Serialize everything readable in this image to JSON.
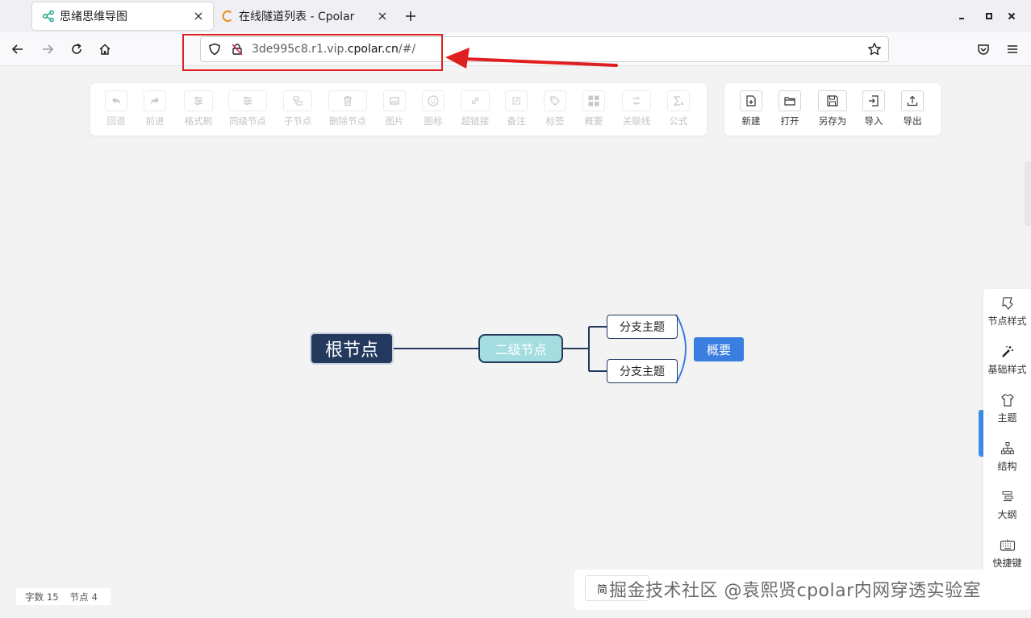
{
  "browser": {
    "tabs": [
      {
        "title": "思绪思维导图",
        "active": true,
        "icon": "mindmap-share-icon"
      },
      {
        "title": "在线隧道列表 - Cpolar",
        "active": false,
        "icon": "cpolar-c-icon"
      }
    ],
    "new_tab": "+",
    "url_host_pre": "3de995c8.r1.vip.",
    "url_host_main": "cpolar.cn",
    "url_path": "/#/"
  },
  "colors": {
    "root_fill": "#233a5e",
    "second_fill": "#a4dde0",
    "summary_fill": "#3a7fe0",
    "annotation_red": "#e02020",
    "sidebar_accent": "#3a8ee6"
  },
  "toolbar": {
    "edit_tools": [
      {
        "label": "回退",
        "icon": "undo-icon"
      },
      {
        "label": "前进",
        "icon": "redo-icon"
      },
      {
        "label": "格式刷",
        "icon": "format-brush-icon"
      },
      {
        "label": "同级节点",
        "icon": "sibling-node-icon"
      },
      {
        "label": "子节点",
        "icon": "child-node-icon"
      },
      {
        "label": "删除节点",
        "icon": "trash-icon"
      },
      {
        "label": "图片",
        "icon": "image-icon"
      },
      {
        "label": "图标",
        "icon": "smiley-icon"
      },
      {
        "label": "超链接",
        "icon": "link-icon"
      },
      {
        "label": "备注",
        "icon": "note-edit-icon"
      },
      {
        "label": "标签",
        "icon": "tag-icon"
      },
      {
        "label": "概要",
        "icon": "summary-grid-icon"
      },
      {
        "label": "关联线",
        "icon": "association-line-icon"
      },
      {
        "label": "公式",
        "icon": "formula-sigma-icon"
      }
    ],
    "file_tools": [
      {
        "label": "新建",
        "icon": "new-file-icon"
      },
      {
        "label": "打开",
        "icon": "folder-open-icon"
      },
      {
        "label": "另存为",
        "icon": "save-as-icon"
      },
      {
        "label": "导入",
        "icon": "import-icon"
      },
      {
        "label": "导出",
        "icon": "export-icon"
      }
    ]
  },
  "mindmap": {
    "root": "根节点",
    "second": "二级节点",
    "branches": [
      "分支主题",
      "分支主题"
    ],
    "summary": "概要"
  },
  "sidebar": [
    {
      "label": "节点样式",
      "icon": "node-style-icon"
    },
    {
      "label": "基础样式",
      "icon": "magic-wand-icon"
    },
    {
      "label": "主题",
      "icon": "tshirt-icon"
    },
    {
      "label": "结构",
      "icon": "structure-tree-icon"
    },
    {
      "label": "大纲",
      "icon": "outline-icon"
    },
    {
      "label": "快捷键",
      "icon": "keyboard-icon"
    }
  ],
  "status": {
    "words_label": "字数",
    "words_value": "15",
    "nodes_label": "节点",
    "nodes_value": "4"
  },
  "bottom": {
    "lang_label": "简",
    "watermark": "掘金技术社区 @袁熙贤cpolar内网穿透实验室"
  }
}
